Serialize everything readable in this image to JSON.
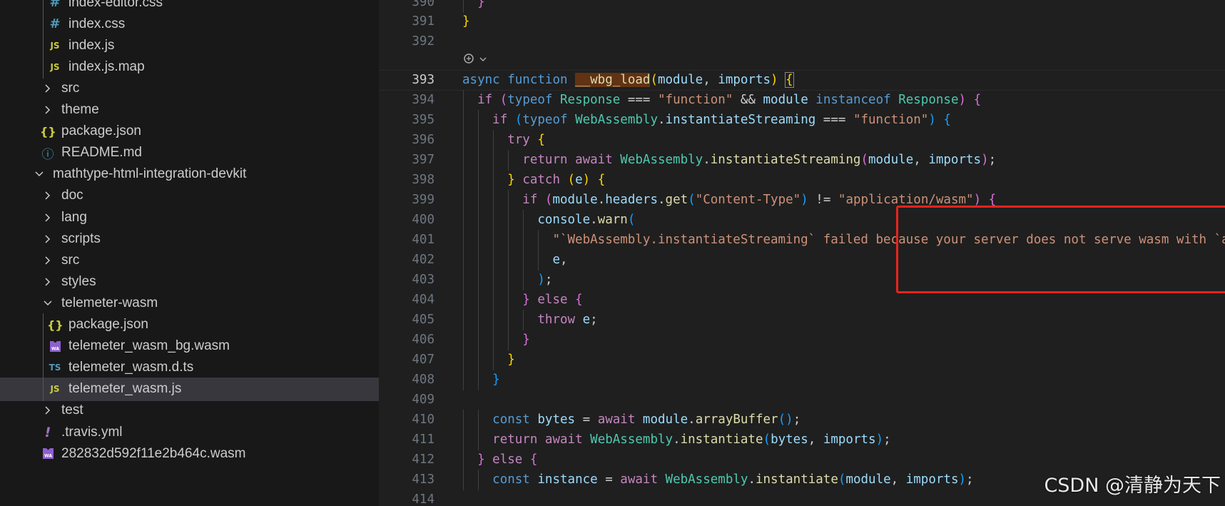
{
  "explorer": {
    "items": [
      {
        "label": "index-editor.css",
        "icon": "css-file-icon",
        "glyph": "#",
        "depth": 2
      },
      {
        "label": "index.css",
        "icon": "css-file-icon",
        "glyph": "#",
        "depth": 2
      },
      {
        "label": "index.js",
        "icon": "js-file-icon",
        "glyph": "JS",
        "depth": 2
      },
      {
        "label": "index.js.map",
        "icon": "js-file-icon",
        "glyph": "JS",
        "depth": 2
      },
      {
        "label": "src",
        "icon": "chevron-right-icon",
        "glyph": "›",
        "depth": 1,
        "folder": true
      },
      {
        "label": "theme",
        "icon": "chevron-right-icon",
        "glyph": "›",
        "depth": 1,
        "folder": true
      },
      {
        "label": "package.json",
        "icon": "json-file-icon",
        "glyph": "{}",
        "depth": 1
      },
      {
        "label": "README.md",
        "icon": "info-icon",
        "glyph": "ⓘ",
        "depth": 1
      },
      {
        "label": "mathtype-html-integration-devkit",
        "icon": "chevron-down-icon",
        "glyph": "⌄",
        "depth": 0,
        "folder": true,
        "open": true
      },
      {
        "label": "doc",
        "icon": "chevron-right-icon",
        "glyph": "›",
        "depth": 1,
        "folder": true
      },
      {
        "label": "lang",
        "icon": "chevron-right-icon",
        "glyph": "›",
        "depth": 1,
        "folder": true
      },
      {
        "label": "scripts",
        "icon": "chevron-right-icon",
        "glyph": "›",
        "depth": 1,
        "folder": true
      },
      {
        "label": "src",
        "icon": "chevron-right-icon",
        "glyph": "›",
        "depth": 1,
        "folder": true
      },
      {
        "label": "styles",
        "icon": "chevron-right-icon",
        "glyph": "›",
        "depth": 1,
        "folder": true
      },
      {
        "label": "telemeter-wasm",
        "icon": "chevron-down-icon",
        "glyph": "⌄",
        "depth": 1,
        "folder": true,
        "open": true
      },
      {
        "label": "package.json",
        "icon": "json-file-icon",
        "glyph": "{}",
        "depth": 2
      },
      {
        "label": "telemeter_wasm_bg.wasm",
        "icon": "wasm-file-icon",
        "glyph": "WA",
        "depth": 2
      },
      {
        "label": "telemeter_wasm.d.ts",
        "icon": "ts-file-icon",
        "glyph": "TS",
        "depth": 2
      },
      {
        "label": "telemeter_wasm.js",
        "icon": "js-file-icon",
        "glyph": "JS",
        "depth": 2,
        "selected": true
      },
      {
        "label": "test",
        "icon": "chevron-right-icon",
        "glyph": "›",
        "depth": 1,
        "folder": true
      },
      {
        "label": ".travis.yml",
        "icon": "yml-file-icon",
        "glyph": "!",
        "depth": 1
      },
      {
        "label": "282832d592f11e2b464c.wasm",
        "icon": "wasm-file-icon",
        "glyph": "WA",
        "depth": 1
      }
    ]
  },
  "editor": {
    "active_line": "393",
    "lines": [
      {
        "n": "390",
        "tokens": [
          [
            "  ",
            "d"
          ],
          [
            "}",
            "b2"
          ]
        ]
      },
      {
        "n": "391",
        "tokens": [
          [
            "}",
            "b1"
          ]
        ]
      },
      {
        "n": "392",
        "tokens": []
      },
      {
        "n": "393",
        "tokens": [
          [
            "async",
            "k"
          ],
          [
            " ",
            "d"
          ],
          [
            "function",
            "k"
          ],
          [
            " ",
            "d"
          ],
          [
            "__wbg_load",
            "f hl"
          ],
          [
            "(",
            "b1"
          ],
          [
            "module",
            "p"
          ],
          [
            ", ",
            "d"
          ],
          [
            "imports",
            "p"
          ],
          [
            ")",
            "b1"
          ],
          [
            " ",
            "d"
          ],
          [
            "{",
            "b1 bmatch"
          ]
        ]
      },
      {
        "n": "394",
        "tokens": [
          [
            "  ",
            "d"
          ],
          [
            "if",
            "c"
          ],
          [
            " ",
            "d"
          ],
          [
            "(",
            "b2"
          ],
          [
            "typeof",
            "k"
          ],
          [
            " ",
            "d"
          ],
          [
            "Response",
            "t"
          ],
          [
            " === ",
            "d"
          ],
          [
            "\"function\"",
            "s"
          ],
          [
            " && ",
            "d"
          ],
          [
            "module",
            "p"
          ],
          [
            " ",
            "d"
          ],
          [
            "instanceof",
            "k"
          ],
          [
            " ",
            "d"
          ],
          [
            "Response",
            "t"
          ],
          [
            ")",
            "b2"
          ],
          [
            " ",
            "d"
          ],
          [
            "{",
            "b2"
          ]
        ]
      },
      {
        "n": "395",
        "tokens": [
          [
            "    ",
            "d"
          ],
          [
            "if",
            "c"
          ],
          [
            " ",
            "d"
          ],
          [
            "(",
            "b3"
          ],
          [
            "typeof",
            "k"
          ],
          [
            " ",
            "d"
          ],
          [
            "WebAssembly",
            "t"
          ],
          [
            ".",
            "d"
          ],
          [
            "instantiateStreaming",
            "p"
          ],
          [
            " === ",
            "d"
          ],
          [
            "\"function\"",
            "s"
          ],
          [
            ")",
            "b3"
          ],
          [
            " ",
            "d"
          ],
          [
            "{",
            "b3"
          ]
        ]
      },
      {
        "n": "396",
        "tokens": [
          [
            "      ",
            "d"
          ],
          [
            "try",
            "c"
          ],
          [
            " ",
            "d"
          ],
          [
            "{",
            "b1"
          ]
        ]
      },
      {
        "n": "397",
        "tokens": [
          [
            "        ",
            "d"
          ],
          [
            "return",
            "c"
          ],
          [
            " ",
            "d"
          ],
          [
            "await",
            "c"
          ],
          [
            " ",
            "d"
          ],
          [
            "WebAssembly",
            "t"
          ],
          [
            ".",
            "d"
          ],
          [
            "instantiateStreaming",
            "f"
          ],
          [
            "(",
            "b2"
          ],
          [
            "module",
            "p"
          ],
          [
            ", ",
            "d"
          ],
          [
            "imports",
            "p"
          ],
          [
            ")",
            "b2"
          ],
          [
            ";",
            "d"
          ]
        ]
      },
      {
        "n": "398",
        "tokens": [
          [
            "      ",
            "d"
          ],
          [
            "}",
            "b1"
          ],
          [
            " ",
            "d"
          ],
          [
            "catch",
            "c"
          ],
          [
            " ",
            "d"
          ],
          [
            "(",
            "b1"
          ],
          [
            "e",
            "p"
          ],
          [
            ")",
            "b1"
          ],
          [
            " ",
            "d"
          ],
          [
            "{",
            "b1"
          ]
        ]
      },
      {
        "n": "399",
        "tokens": [
          [
            "        ",
            "d"
          ],
          [
            "if",
            "c"
          ],
          [
            " ",
            "d"
          ],
          [
            "(",
            "b2"
          ],
          [
            "module",
            "p"
          ],
          [
            ".",
            "d"
          ],
          [
            "headers",
            "p"
          ],
          [
            ".",
            "d"
          ],
          [
            "get",
            "f"
          ],
          [
            "(",
            "b3"
          ],
          [
            "\"Content-Type\"",
            "s"
          ],
          [
            ")",
            "b3"
          ],
          [
            " != ",
            "d"
          ],
          [
            "\"application/wasm\"",
            "s"
          ],
          [
            ")",
            "b2"
          ],
          [
            " ",
            "d"
          ],
          [
            "{",
            "b2"
          ]
        ]
      },
      {
        "n": "400",
        "tokens": [
          [
            "          ",
            "d"
          ],
          [
            "console",
            "p"
          ],
          [
            ".",
            "d"
          ],
          [
            "warn",
            "f"
          ],
          [
            "(",
            "b3"
          ]
        ]
      },
      {
        "n": "401",
        "tokens": [
          [
            "            ",
            "d"
          ],
          [
            "\"`WebAssembly.instantiateStreaming` failed because your server does not serve wasm with `application/wasm` MIME type.\"",
            "s"
          ],
          [
            ",",
            "d"
          ]
        ]
      },
      {
        "n": "402",
        "tokens": [
          [
            "            ",
            "d"
          ],
          [
            "e",
            "p"
          ],
          [
            ",",
            "d"
          ]
        ]
      },
      {
        "n": "403",
        "tokens": [
          [
            "          ",
            "d"
          ],
          [
            ")",
            "b3"
          ],
          [
            ";",
            "d"
          ]
        ]
      },
      {
        "n": "404",
        "tokens": [
          [
            "        ",
            "d"
          ],
          [
            "}",
            "b2"
          ],
          [
            " ",
            "d"
          ],
          [
            "else",
            "c"
          ],
          [
            " ",
            "d"
          ],
          [
            "{",
            "b2"
          ]
        ]
      },
      {
        "n": "405",
        "tokens": [
          [
            "          ",
            "d"
          ],
          [
            "throw",
            "c"
          ],
          [
            " ",
            "d"
          ],
          [
            "e",
            "p"
          ],
          [
            ";",
            "d"
          ]
        ]
      },
      {
        "n": "406",
        "tokens": [
          [
            "        ",
            "d"
          ],
          [
            "}",
            "b2"
          ]
        ]
      },
      {
        "n": "407",
        "tokens": [
          [
            "      ",
            "d"
          ],
          [
            "}",
            "b1"
          ]
        ]
      },
      {
        "n": "408",
        "tokens": [
          [
            "    ",
            "d"
          ],
          [
            "}",
            "b3"
          ]
        ]
      },
      {
        "n": "409",
        "tokens": []
      },
      {
        "n": "410",
        "tokens": [
          [
            "    ",
            "d"
          ],
          [
            "const",
            "k"
          ],
          [
            " ",
            "d"
          ],
          [
            "bytes",
            "p"
          ],
          [
            " = ",
            "d"
          ],
          [
            "await",
            "c"
          ],
          [
            " ",
            "d"
          ],
          [
            "module",
            "p"
          ],
          [
            ".",
            "d"
          ],
          [
            "arrayBuffer",
            "f"
          ],
          [
            "(",
            "b3"
          ],
          [
            ")",
            "b3"
          ],
          [
            ";",
            "d"
          ]
        ]
      },
      {
        "n": "411",
        "tokens": [
          [
            "    ",
            "d"
          ],
          [
            "return",
            "c"
          ],
          [
            " ",
            "d"
          ],
          [
            "await",
            "c"
          ],
          [
            " ",
            "d"
          ],
          [
            "WebAssembly",
            "t"
          ],
          [
            ".",
            "d"
          ],
          [
            "instantiate",
            "f"
          ],
          [
            "(",
            "b3"
          ],
          [
            "bytes",
            "p"
          ],
          [
            ", ",
            "d"
          ],
          [
            "imports",
            "p"
          ],
          [
            ")",
            "b3"
          ],
          [
            ";",
            "d"
          ]
        ]
      },
      {
        "n": "412",
        "tokens": [
          [
            "  ",
            "d"
          ],
          [
            "}",
            "b2"
          ],
          [
            " ",
            "d"
          ],
          [
            "else",
            "c"
          ],
          [
            " ",
            "d"
          ],
          [
            "{",
            "b2"
          ]
        ]
      },
      {
        "n": "413",
        "tokens": [
          [
            "    ",
            "d"
          ],
          [
            "const",
            "k"
          ],
          [
            " ",
            "d"
          ],
          [
            "instance",
            "p"
          ],
          [
            " = ",
            "d"
          ],
          [
            "await",
            "c"
          ],
          [
            " ",
            "d"
          ],
          [
            "WebAssembly",
            "t"
          ],
          [
            ".",
            "d"
          ],
          [
            "instantiate",
            "f"
          ],
          [
            "(",
            "b3"
          ],
          [
            "module",
            "p"
          ],
          [
            ", ",
            "d"
          ],
          [
            "imports",
            "p"
          ],
          [
            ")",
            "b3"
          ],
          [
            ";",
            "d"
          ]
        ]
      },
      {
        "n": "414",
        "tokens": []
      }
    ]
  },
  "watermark": "CSDN @清静为天下",
  "colors": {
    "sidebar_bg": "#181818",
    "editor_bg": "#1f1f1f",
    "selected_row": "#37373d",
    "annotation_box": "#e8231c"
  }
}
